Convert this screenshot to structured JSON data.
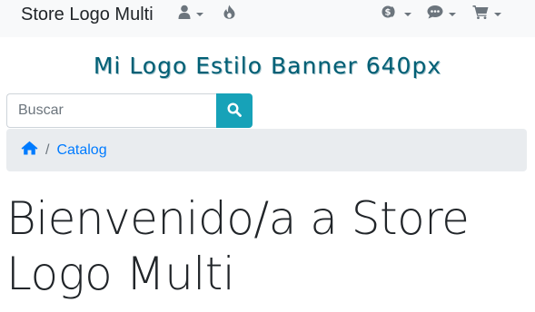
{
  "navbar": {
    "brand": "Store Logo Multi",
    "icons": [
      "user-icon",
      "fire-icon",
      "currency-icon",
      "comments-icon",
      "cart-icon"
    ]
  },
  "banner": {
    "text": "Mi Logo Estilo Banner 640px"
  },
  "search": {
    "placeholder": "Buscar",
    "value": "",
    "button_icon": "search-icon"
  },
  "breadcrumb": {
    "home_icon": "home-icon",
    "separator": "/",
    "items": [
      "Catalog"
    ]
  },
  "main": {
    "heading": "Bienvenido/a a Store Logo Multi"
  },
  "colors": {
    "navbar_bg": "#f8f9fa",
    "accent": "#17a2b8",
    "link": "#007bff",
    "banner": "#005f75",
    "breadcrumb_bg": "#e9ecef"
  }
}
